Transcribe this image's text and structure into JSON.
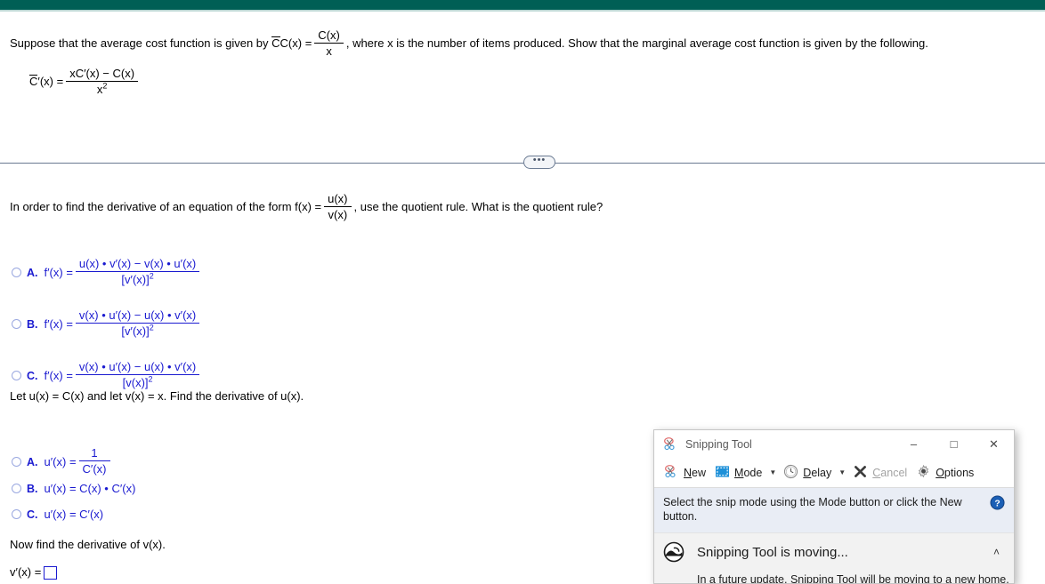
{
  "colors": {
    "header_teal": "#005f55",
    "answer_blue": "#1a1ad0",
    "hint_bg": "#e9edf5"
  },
  "problem": {
    "statement_part1": "Suppose that the average cost function is given by",
    "cbar_label": "C(x) =",
    "cbar_overline": "C",
    "frac1_num": "C(x)",
    "frac1_den": "x",
    "statement_part2": ", where x is the number of items produced. Show that the marginal average cost function is given by the following.",
    "result_lhs_overline": "C",
    "result_lhs": "′(x) =",
    "result_num": "xC′(x) − C(x)",
    "result_den": "x",
    "result_den_exp": "2"
  },
  "divider": {
    "handle_label": "•••"
  },
  "question1": {
    "prompt_part1": "In order to find the derivative of an equation of the form f(x) =",
    "frac_num": "u(x)",
    "frac_den": "v(x)",
    "prompt_part2": ", use the quotient rule. What is the quotient rule?",
    "options": [
      {
        "letter": "A.",
        "lhs": "f′(x) =",
        "num": "u(x) • v′(x) − v(x) • u′(x)",
        "den": "[v′(x)]",
        "den_exp": "2"
      },
      {
        "letter": "B.",
        "lhs": "f′(x) =",
        "num": "v(x) • u′(x) − u(x) • v′(x)",
        "den": "[v′(x)]",
        "den_exp": "2"
      },
      {
        "letter": "C.",
        "lhs": "f′(x) =",
        "num": "v(x) • u′(x) − u(x) • v′(x)",
        "den": "[v(x)]",
        "den_exp": "2"
      }
    ]
  },
  "question2": {
    "prompt": "Let u(x) = C(x) and let v(x) = x. Find the derivative of u(x).",
    "options": [
      {
        "letter": "A.",
        "lhs": "u′(x) =",
        "num": "1",
        "den": "C′(x)",
        "plain": ""
      },
      {
        "letter": "B.",
        "lhs": "",
        "plain": "u′(x) = C(x) • C′(x)"
      },
      {
        "letter": "C.",
        "lhs": "",
        "plain": "u′(x) = C′(x)"
      }
    ]
  },
  "question3": {
    "prompt": "Now find the derivative of v(x).",
    "answer_lhs": "v′(x) =",
    "answer_value": ""
  },
  "snipping_tool": {
    "title": "Snipping Tool",
    "app_icon": "scissors-icon",
    "window_buttons": {
      "minimize": "–",
      "maximize": "□",
      "close": "✕"
    },
    "toolbar": [
      {
        "id": "new",
        "label": "New",
        "accel": "N",
        "icon": "scissors-icon",
        "has_caret": false,
        "disabled": false
      },
      {
        "id": "mode",
        "label": "Mode",
        "accel": "M",
        "icon": "selection-rectangle-icon",
        "has_caret": true,
        "disabled": false
      },
      {
        "id": "delay",
        "label": "Delay",
        "accel": "D",
        "icon": "clock-icon",
        "has_caret": true,
        "disabled": false
      },
      {
        "id": "cancel",
        "label": "Cancel",
        "accel": "C",
        "icon": "x-mark-icon",
        "has_caret": false,
        "disabled": true
      },
      {
        "id": "options",
        "label": "Options",
        "accel": "O",
        "icon": "gear-icon",
        "has_caret": false,
        "disabled": false
      }
    ],
    "hint": "Select the snip mode using the Mode button or click the New button.",
    "help_icon": "question-mark-help-icon",
    "notice": {
      "icon": "snip-and-sketch-icon",
      "text": "Snipping Tool is moving...",
      "chevron": "˄",
      "detail": "In a future update, Snipping Tool will be moving to a new home."
    }
  }
}
